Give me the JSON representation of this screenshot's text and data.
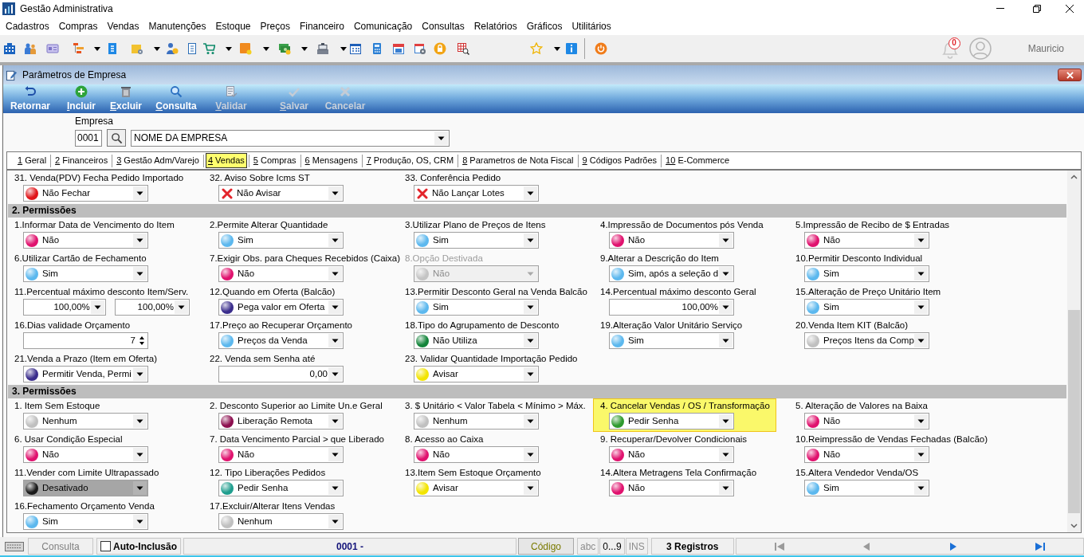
{
  "window": {
    "title": "Gestão Administrativa"
  },
  "menu": [
    "Cadastros",
    "Compras",
    "Vendas",
    "Manutenções",
    "Estoque",
    "Preços",
    "Financeiro",
    "Comunicação",
    "Consultas",
    "Relatórios",
    "Gráficos",
    "Utilitários"
  ],
  "user": {
    "notifications": "0",
    "name": "Mauricio"
  },
  "form": {
    "title": "Parâmetros de Empresa",
    "toolbar": [
      {
        "label": "Retornar",
        "mnemonic": false,
        "disabled": false
      },
      {
        "label": "Incluir",
        "mnemonic": true,
        "disabled": false
      },
      {
        "label": "Excluir",
        "mnemonic": true,
        "disabled": false
      },
      {
        "label": "Consulta",
        "mnemonic": true,
        "disabled": false
      },
      {
        "label": "Validar",
        "mnemonic": true,
        "disabled": true
      },
      {
        "label": "Salvar",
        "mnemonic": true,
        "disabled": true
      },
      {
        "label": "Cancelar",
        "mnemonic": false,
        "disabled": true
      }
    ],
    "company": {
      "label": "Empresa",
      "code": "0001",
      "name": "NOME DA EMPRESA"
    },
    "tabs": [
      {
        "number": "1",
        "label": "Geral",
        "selected": false
      },
      {
        "number": "2",
        "label": "Financeiros",
        "selected": false
      },
      {
        "number": "3",
        "label": "Gestão Adm/Varejo",
        "selected": false
      },
      {
        "number": "4",
        "label": "Vendas",
        "selected": true
      },
      {
        "number": "5",
        "label": "Compras",
        "selected": false
      },
      {
        "number": "6",
        "label": "Mensagens",
        "selected": false
      },
      {
        "number": "7",
        "label": "Produção, OS, CRM",
        "selected": false
      },
      {
        "number": "8",
        "label": "Parametros de Nota Fiscal",
        "selected": false
      },
      {
        "number": "9",
        "label": "Códigos Padrões",
        "selected": false
      },
      {
        "number": "10",
        "label": "E-Commerce",
        "selected": false
      }
    ],
    "sections": [
      {
        "rows": [
          [
            {
              "label": "31. Venda(PDV) Fecha Pedido Importado",
              "kind": "select",
              "marker": {
                "kind": "dot",
                "color": "#e0161b"
              },
              "value": "Não Fechar",
              "disabled": false,
              "highlighted": false,
              "shaded": false
            },
            {
              "label": "32. Aviso Sobre Icms ST",
              "kind": "select",
              "marker": {
                "kind": "cross"
              },
              "value": "Não Avisar",
              "disabled": false,
              "highlighted": false,
              "shaded": false
            },
            {
              "label": "33. Conferência Pedido",
              "kind": "select",
              "marker": {
                "kind": "cross"
              },
              "value": "Não Lançar Lotes",
              "disabled": false,
              "highlighted": false,
              "shaded": false
            }
          ]
        ]
      },
      {
        "title": "2. Permissões",
        "rows": [
          [
            {
              "label": "1.Informar Data de Vencimento do Item",
              "kind": "select",
              "marker": {
                "kind": "dot",
                "color": "#e0126e"
              },
              "value": "Não",
              "disabled": false,
              "highlighted": false,
              "shaded": false
            },
            {
              "label": "2.Permite Alterar Quantidade",
              "kind": "select",
              "marker": {
                "kind": "dot",
                "color": "#5cb8ee"
              },
              "value": "Sim",
              "disabled": false,
              "highlighted": false,
              "shaded": false
            },
            {
              "label": "3.Utilizar Plano de Preços de Itens",
              "kind": "select",
              "marker": {
                "kind": "dot",
                "color": "#5cb8ee"
              },
              "value": "Sim",
              "disabled": false,
              "highlighted": false,
              "shaded": false
            },
            {
              "label": "4.Impressão de Documentos pós Venda",
              "kind": "select",
              "marker": {
                "kind": "dot",
                "color": "#e0126e"
              },
              "value": "Não",
              "disabled": false,
              "highlighted": false,
              "shaded": false
            },
            {
              "label": "5.Impressão de Recibo de $ Entradas",
              "kind": "select",
              "marker": {
                "kind": "dot",
                "color": "#e0126e"
              },
              "value": "Não",
              "disabled": false,
              "highlighted": false,
              "shaded": false
            }
          ],
          [
            {
              "label": "6.Utilizar Cartão de Fechamento",
              "kind": "select",
              "marker": {
                "kind": "dot",
                "color": "#5cb8ee"
              },
              "value": "Sim",
              "disabled": false,
              "highlighted": false,
              "shaded": false
            },
            {
              "label": "7.Exigir Obs. para Cheques Recebidos (Caixa)",
              "kind": "select",
              "marker": {
                "kind": "dot",
                "color": "#e0126e"
              },
              "value": "Não",
              "disabled": false,
              "highlighted": false,
              "shaded": false
            },
            {
              "label": "8.Opção Destivada",
              "kind": "select",
              "marker": {
                "kind": "dot",
                "color": "#c4c4c4"
              },
              "value": "Não",
              "disabled": true,
              "highlighted": false,
              "shaded": false
            },
            {
              "label": "9.Alterar a Descrição do Item",
              "kind": "select",
              "marker": {
                "kind": "dot",
                "color": "#5cb8ee"
              },
              "value": "Sim, após a seleção d",
              "disabled": false,
              "highlighted": false,
              "shaded": false
            },
            {
              "label": "10.Permitir Desconto Individual",
              "kind": "select",
              "marker": {
                "kind": "dot",
                "color": "#5cb8ee"
              },
              "value": "Sim",
              "disabled": false,
              "highlighted": false,
              "shaded": false
            }
          ],
          [
            {
              "label": "11.Percentual máximo desconto Item/Serv.",
              "kind": "numeric_pair",
              "values": [
                "100,00%",
                "100,00%"
              ],
              "disabled": false,
              "highlighted": false,
              "shaded": false
            },
            {
              "label": "12.Quando em Oferta (Balcão)",
              "kind": "select",
              "marker": {
                "kind": "dot",
                "color": "#3a2d8c"
              },
              "value": "Pega valor em Oferta",
              "disabled": false,
              "highlighted": false,
              "shaded": false
            },
            {
              "label": "13.Permitir Desconto Geral na Venda Balcão",
              "kind": "select",
              "marker": {
                "kind": "dot",
                "color": "#5cb8ee"
              },
              "value": "Sim",
              "disabled": false,
              "highlighted": false,
              "shaded": false
            },
            {
              "label": "14.Percentual máximo desconto Geral",
              "kind": "numeric",
              "value": "100,00%",
              "disabled": false,
              "highlighted": false,
              "shaded": false
            },
            {
              "label": "15.Alteração de Preço Unitário Item",
              "kind": "select",
              "marker": {
                "kind": "dot",
                "color": "#5cb8ee"
              },
              "value": "Sim",
              "disabled": false,
              "highlighted": false,
              "shaded": false
            }
          ],
          [
            {
              "label": "16.Dias validade Orçamento",
              "kind": "spin",
              "value": "7",
              "disabled": false,
              "highlighted": false,
              "shaded": false
            },
            {
              "label": "17.Preço ao Recuperar Orçamento",
              "kind": "select",
              "marker": {
                "kind": "dot",
                "color": "#5cb8ee"
              },
              "value": "Preços da Venda",
              "disabled": false,
              "highlighted": false,
              "shaded": false
            },
            {
              "label": "18.Tipo do Agrupamento de Desconto",
              "kind": "select",
              "marker": {
                "kind": "dot",
                "color": "#13843a"
              },
              "value": "Não Utiliza",
              "disabled": false,
              "highlighted": false,
              "shaded": false
            },
            {
              "label": "19.Alteração Valor Unitário Serviço",
              "kind": "select",
              "marker": {
                "kind": "dot",
                "color": "#5cb8ee"
              },
              "value": "Sim",
              "disabled": false,
              "highlighted": false,
              "shaded": false
            },
            {
              "label": "20.Venda Item KIT (Balcão)",
              "kind": "select",
              "marker": {
                "kind": "dot",
                "color": "#c0c0c0"
              },
              "value": "Preços Itens da Comp",
              "disabled": false,
              "highlighted": false,
              "shaded": false
            }
          ],
          [
            {
              "label": "21.Venda a Prazo (Item em Oferta)",
              "kind": "select",
              "marker": {
                "kind": "dot",
                "color": "#3a2d8c"
              },
              "value": "Permitir Venda, Permi",
              "disabled": false,
              "highlighted": false,
              "shaded": false
            },
            {
              "label": "22. Venda sem Senha até",
              "kind": "numeric",
              "value": "0,00",
              "disabled": false,
              "highlighted": false,
              "shaded": false
            },
            {
              "label": "23. Validar Quantidade Importação Pedido",
              "kind": "select",
              "marker": {
                "kind": "dot",
                "color": "#f2e400"
              },
              "value": "Avisar",
              "disabled": false,
              "highlighted": false,
              "shaded": false
            }
          ]
        ]
      },
      {
        "title": "3. Permissões",
        "rows": [
          [
            {
              "label": "1. Item Sem Estoque",
              "kind": "select",
              "marker": {
                "kind": "dot",
                "color": "#c0c0c0"
              },
              "value": "Nenhum",
              "disabled": false,
              "highlighted": false,
              "shaded": false
            },
            {
              "label": "2. Desconto Superior ao Limite Un.e Geral",
              "kind": "select",
              "marker": {
                "kind": "dot",
                "color": "#8c0f4f"
              },
              "value": "Liberação Remota",
              "disabled": false,
              "highlighted": false,
              "shaded": false
            },
            {
              "label": "3. $ Unitário < Valor Tabela < Mínimo > Máx.",
              "kind": "select",
              "marker": {
                "kind": "dot",
                "color": "#c0c0c0"
              },
              "value": "Nenhum",
              "disabled": false,
              "highlighted": false,
              "shaded": false
            },
            {
              "label": "4. Cancelar Vendas / OS / Transformação",
              "kind": "select",
              "marker": {
                "kind": "dot",
                "color": "#2e9a2e"
              },
              "value": "Pedir Senha",
              "disabled": false,
              "highlighted": true,
              "shaded": false
            },
            {
              "label": "5. Alteração de Valores na Baixa",
              "kind": "select",
              "marker": {
                "kind": "dot",
                "color": "#e0126e"
              },
              "value": "Não",
              "disabled": false,
              "highlighted": false,
              "shaded": false
            }
          ],
          [
            {
              "label": "6. Usar Condição Especial",
              "kind": "select",
              "marker": {
                "kind": "dot",
                "color": "#e0126e"
              },
              "value": "Não",
              "disabled": false,
              "highlighted": false,
              "shaded": false
            },
            {
              "label": "7. Data Vencimento Parcial > que Liberado",
              "kind": "select",
              "marker": {
                "kind": "dot",
                "color": "#e0126e"
              },
              "value": "Não",
              "disabled": false,
              "highlighted": false,
              "shaded": false
            },
            {
              "label": "8. Acesso ao Caixa",
              "kind": "select",
              "marker": {
                "kind": "dot",
                "color": "#e0126e"
              },
              "value": "Não",
              "disabled": false,
              "highlighted": false,
              "shaded": false
            },
            {
              "label": "9. Recuperar/Devolver Condicionais",
              "kind": "select",
              "marker": {
                "kind": "dot",
                "color": "#e0126e"
              },
              "value": "Não",
              "disabled": false,
              "highlighted": false,
              "shaded": false
            },
            {
              "label": "10.Reimpressão de Vendas Fechadas (Balcão)",
              "kind": "select",
              "marker": {
                "kind": "dot",
                "color": "#e0126e"
              },
              "value": "Não",
              "disabled": false,
              "highlighted": false,
              "shaded": false
            }
          ],
          [
            {
              "label": "11.Vender com Limite Ultrapassado",
              "kind": "select",
              "marker": {
                "kind": "dot",
                "color": "#1a1a1a"
              },
              "value": "Desativado",
              "disabled": false,
              "highlighted": false,
              "shaded": true
            },
            {
              "label": "12. Tipo Liberações Pedidos",
              "kind": "select",
              "marker": {
                "kind": "dot",
                "color": "#1f9e8e"
              },
              "value": "Pedir Senha",
              "disabled": false,
              "highlighted": false,
              "shaded": false
            },
            {
              "label": "13.Item Sem Estoque Orçamento",
              "kind": "select",
              "marker": {
                "kind": "dot",
                "color": "#f2e400"
              },
              "value": "Avisar",
              "disabled": false,
              "highlighted": false,
              "shaded": false
            },
            {
              "label": "14.Altera Metragens Tela Confirmação",
              "kind": "select",
              "marker": {
                "kind": "dot",
                "color": "#e0126e"
              },
              "value": "Não",
              "disabled": false,
              "highlighted": false,
              "shaded": false
            },
            {
              "label": "15.Altera Vendedor Venda/OS",
              "kind": "select",
              "marker": {
                "kind": "dot",
                "color": "#5cb8ee"
              },
              "value": "Sim",
              "disabled": false,
              "highlighted": false,
              "shaded": false
            }
          ],
          [
            {
              "label": "16.Fechamento Orçamento Venda",
              "kind": "select",
              "marker": {
                "kind": "dot",
                "color": "#5cb8ee"
              },
              "value": "Sim",
              "disabled": false,
              "highlighted": false,
              "shaded": false
            },
            {
              "label": "17.Excluir/Alterar Itens Vendas",
              "kind": "select",
              "marker": {
                "kind": "dot",
                "color": "#c0c0c0"
              },
              "value": "Nenhum",
              "disabled": false,
              "highlighted": false,
              "shaded": false
            }
          ]
        ]
      }
    ]
  },
  "status_bar": {
    "mode": "Consulta",
    "auto_inclusion": {
      "label": "Auto-Inclusão",
      "checked": false
    },
    "record": "0001 -",
    "field": "Código",
    "indicators": [
      {
        "label": "abc",
        "on": false
      },
      {
        "label": "0...9",
        "on": true
      },
      {
        "label": "INS",
        "on": false
      }
    ],
    "count": "3 Registros",
    "nav": [
      {
        "kind": "first",
        "disabled": true
      },
      {
        "kind": "prev",
        "disabled": true
      },
      {
        "kind": "next",
        "disabled": false
      },
      {
        "kind": "last",
        "disabled": false
      }
    ]
  }
}
